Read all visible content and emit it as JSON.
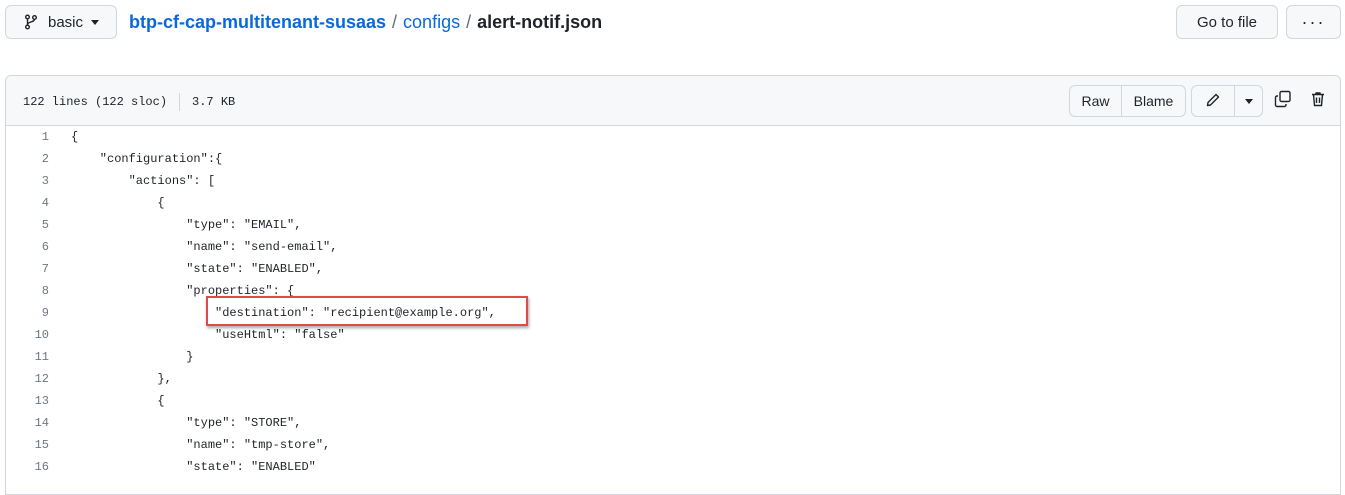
{
  "header": {
    "branch": "basic",
    "repo": "btp-cf-cap-multitenant-susaas",
    "sep1": "/",
    "dir": "configs",
    "sep2": "/",
    "file": "alert-notif.json",
    "goto_label": "Go to file",
    "more_label": "···"
  },
  "file_header": {
    "lines_info": "122 lines (122 sloc)",
    "size": "3.7 KB",
    "raw_label": "Raw",
    "blame_label": "Blame"
  },
  "code_lines": [
    {
      "n": "1",
      "text": "{"
    },
    {
      "n": "2",
      "text": "    \"configuration\":{"
    },
    {
      "n": "3",
      "text": "        \"actions\": ["
    },
    {
      "n": "4",
      "text": "            {"
    },
    {
      "n": "5",
      "text": "                \"type\": \"EMAIL\","
    },
    {
      "n": "6",
      "text": "                \"name\": \"send-email\","
    },
    {
      "n": "7",
      "text": "                \"state\": \"ENABLED\","
    },
    {
      "n": "8",
      "text": "                \"properties\": {"
    },
    {
      "n": "9",
      "text": "                    \"destination\": \"recipient@example.org\","
    },
    {
      "n": "10",
      "text": "                    \"useHtml\": \"false\""
    },
    {
      "n": "11",
      "text": "                }"
    },
    {
      "n": "12",
      "text": "            },"
    },
    {
      "n": "13",
      "text": "            {"
    },
    {
      "n": "14",
      "text": "                \"type\": \"STORE\","
    },
    {
      "n": "15",
      "text": "                \"name\": \"tmp-store\","
    },
    {
      "n": "16",
      "text": "                \"state\": \"ENABLED\""
    }
  ],
  "colors": {
    "link": "#0969da",
    "highlight": "#e04a4a"
  }
}
